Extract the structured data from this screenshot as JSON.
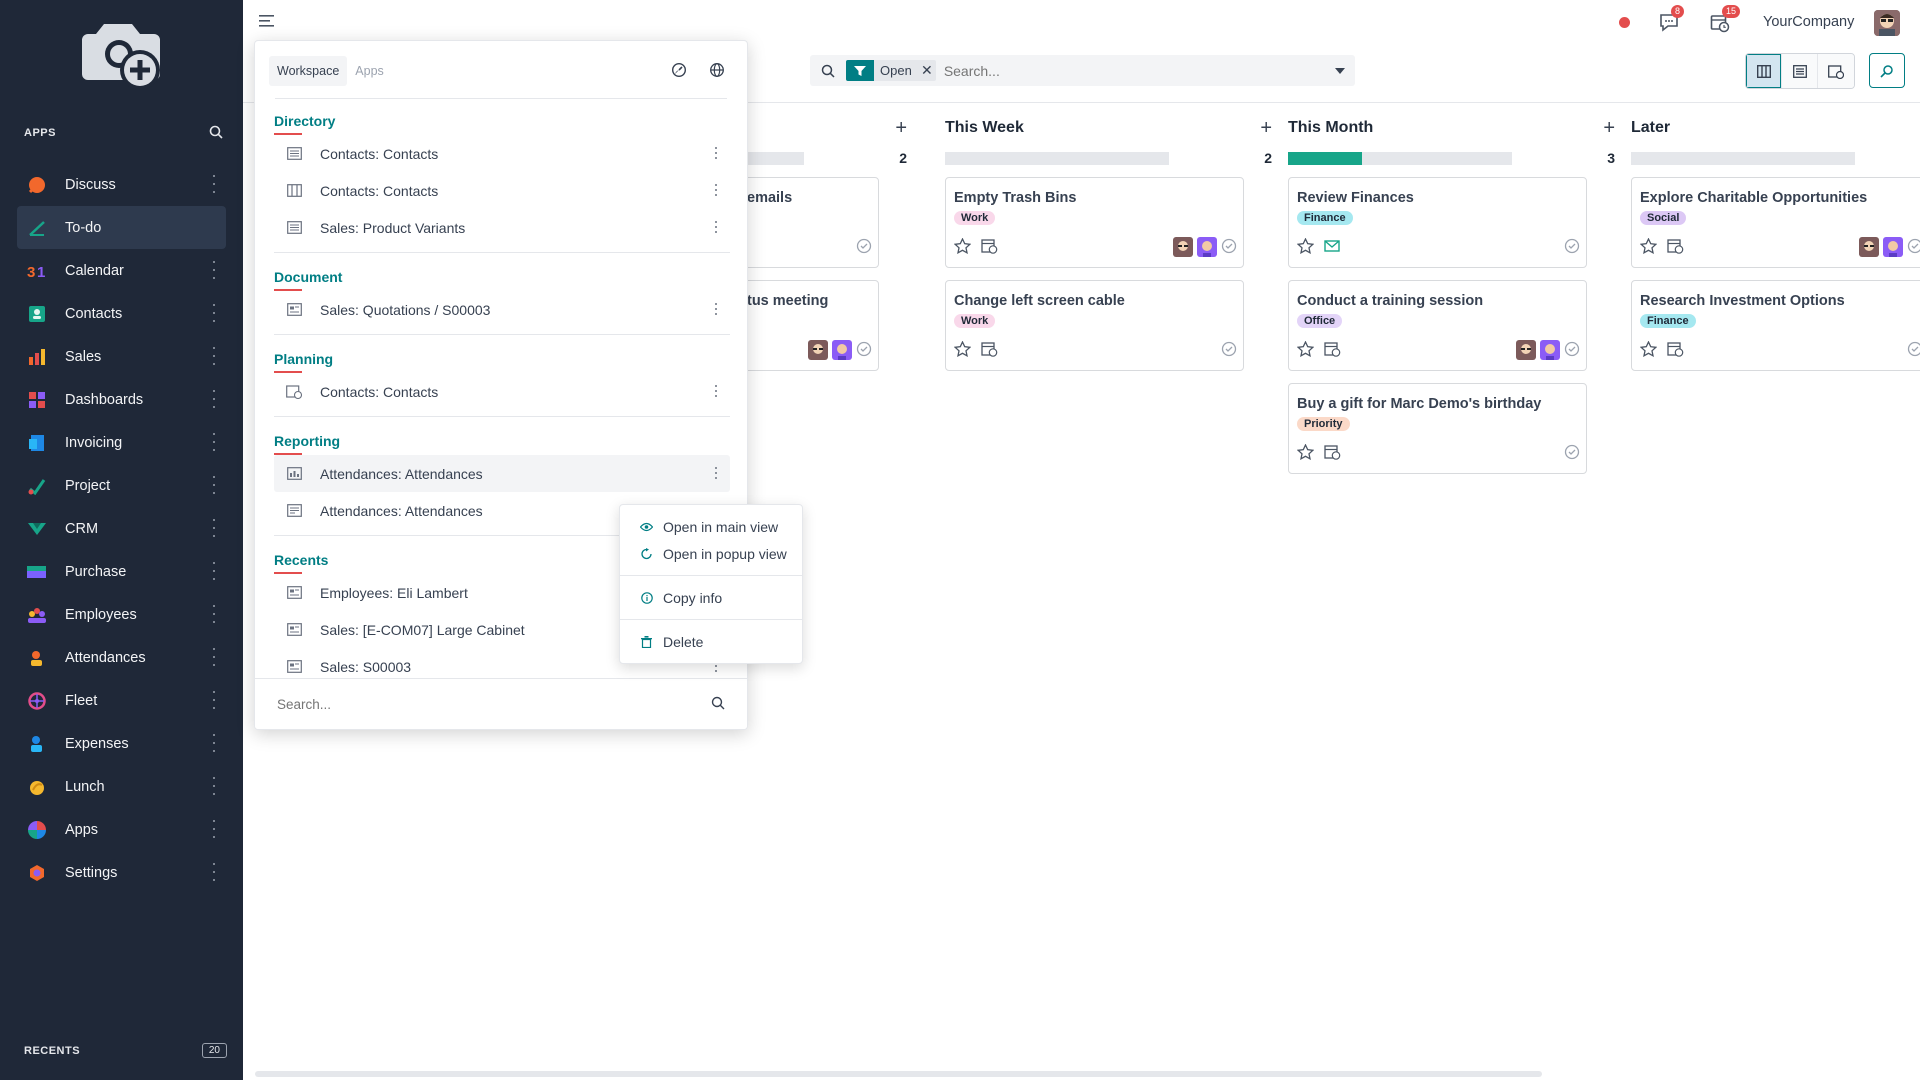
{
  "sidebar": {
    "apps_label": "APPS",
    "items": [
      {
        "label": "Discuss",
        "icon": "discuss-icon"
      },
      {
        "label": "To-do",
        "icon": "todo-icon"
      },
      {
        "label": "Calendar",
        "icon": "calendar-icon"
      },
      {
        "label": "Contacts",
        "icon": "contacts-icon"
      },
      {
        "label": "Sales",
        "icon": "sales-icon"
      },
      {
        "label": "Dashboards",
        "icon": "dashboards-icon"
      },
      {
        "label": "Invoicing",
        "icon": "invoicing-icon"
      },
      {
        "label": "Project",
        "icon": "project-icon"
      },
      {
        "label": "CRM",
        "icon": "crm-icon"
      },
      {
        "label": "Purchase",
        "icon": "purchase-icon"
      },
      {
        "label": "Employees",
        "icon": "employees-icon"
      },
      {
        "label": "Attendances",
        "icon": "attendances-icon"
      },
      {
        "label": "Fleet",
        "icon": "fleet-icon"
      },
      {
        "label": "Expenses",
        "icon": "expenses-icon"
      },
      {
        "label": "Lunch",
        "icon": "lunch-icon"
      },
      {
        "label": "Apps",
        "icon": "apps-icon"
      },
      {
        "label": "Settings",
        "icon": "settings-icon"
      }
    ],
    "active_item": "To-do",
    "recents_label": "RECENTS",
    "recents_count": "20"
  },
  "topbar": {
    "messages_badge": "8",
    "activities_badge": "15",
    "company": "YourCompany"
  },
  "search": {
    "facet_label": "Open",
    "placeholder": "Search..."
  },
  "kanban": {
    "columns": [
      {
        "title": "",
        "count": "2",
        "progress": 0.38,
        "cards": [
          {
            "title": "emails"
          },
          {
            "title": "tus meeting"
          }
        ]
      },
      {
        "title": "This Week",
        "count": "2",
        "progress": 0,
        "cards": [
          {
            "title": "Empty Trash Bins",
            "tag": "Work"
          },
          {
            "title": "Change left screen cable",
            "tag": "Work"
          }
        ]
      },
      {
        "title": "This Month",
        "count": "3",
        "progress": 0.33,
        "cards": [
          {
            "title": "Review Finances",
            "tag": "Finance"
          },
          {
            "title": "Conduct a training session",
            "tag": "Office"
          },
          {
            "title": "Buy a gift for Marc Demo's birthday",
            "tag": "Priority"
          }
        ]
      },
      {
        "title": "Later",
        "count": "",
        "progress": 0,
        "cards": [
          {
            "title": "Explore Charitable Opportunities",
            "tag": "Social"
          },
          {
            "title": "Research Investment Options",
            "tag": "Finance"
          }
        ]
      }
    ],
    "tag_colors": {
      "Work": "#f9d8ea",
      "Finance": "#a5e8f0",
      "Office": "#e3d4f8",
      "Priority": "#fbd9c8",
      "Social": "#dcc8f5"
    }
  },
  "workspace_popover": {
    "tabs": [
      "Workspace",
      "Apps"
    ],
    "active_tab": "Workspace",
    "sections": [
      {
        "title": "Directory",
        "items": [
          {
            "label": "Contacts: Contacts",
            "icon": "list-view-icon"
          },
          {
            "label": "Contacts: Contacts",
            "icon": "kanban-view-icon"
          },
          {
            "label": "Sales: Product Variants",
            "icon": "list-view-icon"
          }
        ]
      },
      {
        "title": "Document",
        "items": [
          {
            "label": "Sales: Quotations / S00003",
            "icon": "form-view-icon"
          }
        ]
      },
      {
        "title": "Planning",
        "items": [
          {
            "label": "Contacts: Contacts",
            "icon": "calendar-view-icon"
          }
        ]
      },
      {
        "title": "Reporting",
        "items": [
          {
            "label": "Attendances: Attendances",
            "icon": "graph-view-icon"
          },
          {
            "label": "Attendances: Attendances",
            "icon": "pivot-view-icon"
          }
        ]
      },
      {
        "title": "Recents",
        "items": [
          {
            "label": "Employees: Eli Lambert",
            "icon": "form-view-icon"
          },
          {
            "label": "Sales: [E-COM07] Large Cabinet",
            "icon": "form-view-icon"
          },
          {
            "label": "Sales: S00003",
            "icon": "form-view-icon"
          }
        ]
      }
    ],
    "search_placeholder": "Search..."
  },
  "context_menu": {
    "items": [
      {
        "label": "Open in main view",
        "icon": "eye-icon"
      },
      {
        "label": "Open in popup view",
        "icon": "popup-icon"
      },
      {
        "label": "Copy info",
        "icon": "info-icon"
      },
      {
        "label": "Delete",
        "icon": "trash-icon"
      }
    ]
  }
}
